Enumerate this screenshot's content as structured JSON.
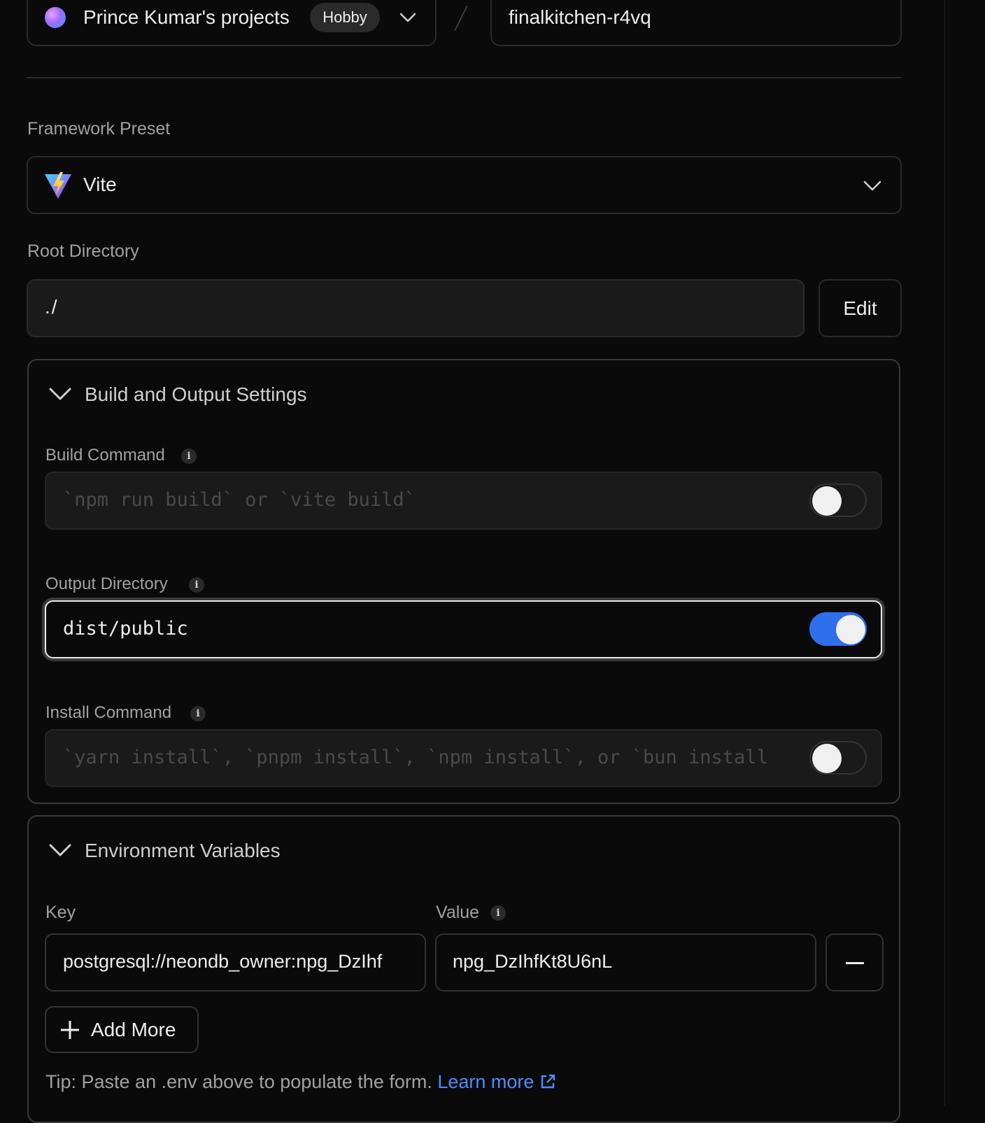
{
  "header": {
    "team_name": "Prince Kumar's projects",
    "plan_badge": "Hobby",
    "project_name": "finalkitchen-r4vq"
  },
  "framework": {
    "label": "Framework Preset",
    "value": "Vite"
  },
  "root_directory": {
    "label": "Root Directory",
    "value": "./",
    "edit_label": "Edit"
  },
  "build_settings": {
    "title": "Build and Output Settings",
    "build_command": {
      "label": "Build Command",
      "placeholder": "`npm run build` or `vite build`",
      "override": false
    },
    "output_directory": {
      "label": "Output Directory",
      "value": "dist/public",
      "override": true
    },
    "install_command": {
      "label": "Install Command",
      "placeholder": "`yarn install`, `pnpm install`, `npm install`, or `bun install",
      "override": false
    }
  },
  "env": {
    "title": "Environment Variables",
    "key_label": "Key",
    "value_label": "Value",
    "rows": [
      {
        "key": "postgresql://neondb_owner:npg_DzIhf",
        "value": "npg_DzIhfKt8U6nL"
      }
    ],
    "add_more_label": "Add More",
    "tip_text": "Tip: Paste an .env above to populate the form.",
    "learn_more_label": "Learn more"
  },
  "colors": {
    "background": "#0a0a0a",
    "border": "#2a2a2a",
    "accent_toggle": "#2f6fec",
    "link": "#4c8dff"
  }
}
